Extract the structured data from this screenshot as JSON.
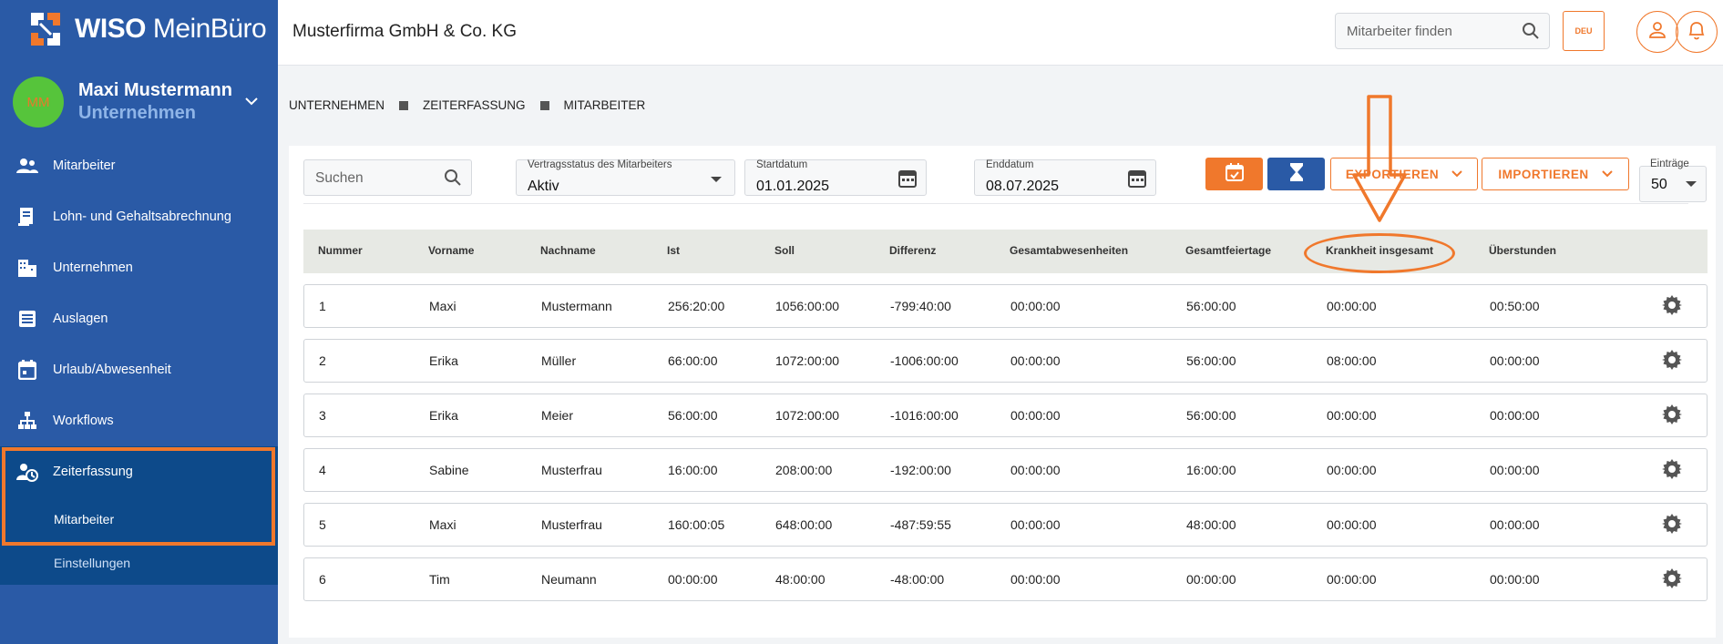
{
  "brand": {
    "name_bold": "WISO",
    "name_rest": " MeinBüro",
    "accent": "#f0782c",
    "sidebar_bg": "#2a5aa6"
  },
  "user": {
    "initials": "MM",
    "name": "Maxi Mustermann",
    "role": "Unternehmen"
  },
  "sidebar": {
    "items": [
      {
        "label": "Mitarbeiter",
        "icon": "people-icon"
      },
      {
        "label": "Lohn- und Gehaltsabrechnung",
        "icon": "payroll-icon"
      },
      {
        "label": "Unternehmen",
        "icon": "building-icon"
      },
      {
        "label": "Auslagen",
        "icon": "receipt-icon"
      },
      {
        "label": "Urlaub/Abwesenheit",
        "icon": "calendar-icon"
      },
      {
        "label": "Workflows",
        "icon": "workflow-icon"
      },
      {
        "label": "Zeiterfassung",
        "icon": "time-tracking-icon"
      }
    ],
    "sub_items": [
      "Mitarbeiter",
      "Einstellungen"
    ]
  },
  "topbar": {
    "company": "Musterfirma GmbH & Co. KG",
    "search_placeholder": "Mitarbeiter finden",
    "language": "DEU"
  },
  "breadcrumb": [
    "UNTERNEHMEN",
    "ZEITERFASSUNG",
    "MITARBEITER"
  ],
  "filters": {
    "search_placeholder": "Suchen",
    "status_label": "Vertragsstatus des Mitarbeiters",
    "status_value": "Aktiv",
    "start_label": "Startdatum",
    "start_value": "01.01.2025",
    "end_label": "Enddatum",
    "end_value": "08.07.2025",
    "export_label": "EXPORTIEREN",
    "import_label": "IMPORTIEREN",
    "entries_label": "Einträge",
    "entries_value": "50"
  },
  "table": {
    "columns": [
      "Nummer",
      "Vorname",
      "Nachname",
      "Ist",
      "Soll",
      "Differenz",
      "Gesamtabwesenheiten",
      "Gesamtfeiertage",
      "Krankheit insgesamt",
      "Überstunden"
    ],
    "rows": [
      [
        "1",
        "Maxi",
        "Mustermann",
        "256:20:00",
        "1056:00:00",
        "-799:40:00",
        "00:00:00",
        "56:00:00",
        "00:00:00",
        "00:50:00"
      ],
      [
        "2",
        "Erika",
        "Müller",
        "66:00:00",
        "1072:00:00",
        "-1006:00:00",
        "00:00:00",
        "56:00:00",
        "08:00:00",
        "00:00:00"
      ],
      [
        "3",
        "Erika",
        "Meier",
        "56:00:00",
        "1072:00:00",
        "-1016:00:00",
        "00:00:00",
        "56:00:00",
        "00:00:00",
        "00:00:00"
      ],
      [
        "4",
        "Sabine",
        "Musterfrau",
        "16:00:00",
        "208:00:00",
        "-192:00:00",
        "00:00:00",
        "16:00:00",
        "00:00:00",
        "00:00:00"
      ],
      [
        "5",
        "Maxi",
        "Musterfrau",
        "160:00:05",
        "648:00:00",
        "-487:59:55",
        "00:00:00",
        "48:00:00",
        "00:00:00",
        "00:00:00"
      ],
      [
        "6",
        "Tim",
        "Neumann",
        "00:00:00",
        "48:00:00",
        "-48:00:00",
        "00:00:00",
        "00:00:00",
        "00:00:00",
        "00:00:00"
      ]
    ]
  }
}
